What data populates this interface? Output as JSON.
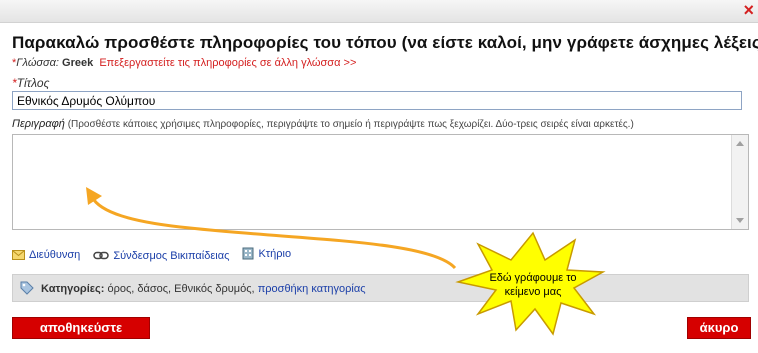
{
  "dialog": {
    "heading": "Παρακαλώ προσθέστε πληροφορίες του τόπου (να είστε καλοί, μην γράφετε άσχημες λέξεις):",
    "close_glyph": "×"
  },
  "language": {
    "required_mark": "*",
    "label": "Γλώσσα:",
    "value": "Greek",
    "edit_link": "Επεξεργαστείτε τις πληροφορίες σε άλλη γλώσσα >>"
  },
  "title_field": {
    "required_mark": "*",
    "label": "Τίτλος",
    "value": "Εθνικός Δρυμός Ολύμπου"
  },
  "description": {
    "label": "Περιγραφή",
    "hint": "(Προσθέστε κάποιες χρήσιμες πληροφορίες, περιγράψτε το σημείο ή περιγράψτε πως ξεχωρίζει. Δύο-τρεις σειρές είναι αρκετές.)",
    "value": ""
  },
  "links": [
    {
      "label": "Διεύθυνση",
      "icon": "envelope-icon"
    },
    {
      "label": "Σύνδεσμος Βικιπαίδειας",
      "icon": "chain-link-icon"
    },
    {
      "label": "Κτήριο",
      "icon": "building-icon"
    }
  ],
  "categories": {
    "label": "Κατηγορίες:",
    "values": "όρος, δάσος, Εθνικός δρυμός,",
    "add_link": "προσθήκη κατηγορίας",
    "icon": "tag-icon"
  },
  "buttons": {
    "save": "αποθηκεύστε",
    "cancel": "άκυρο"
  },
  "annotation": {
    "line1": "Εδώ γράφουμε το",
    "line2": "κείμενο μας",
    "star_color": "#ffff00",
    "arrow_color": "#f5a623"
  },
  "colors": {
    "accent_red": "#d60000",
    "link_blue": "#1a3ea8"
  }
}
